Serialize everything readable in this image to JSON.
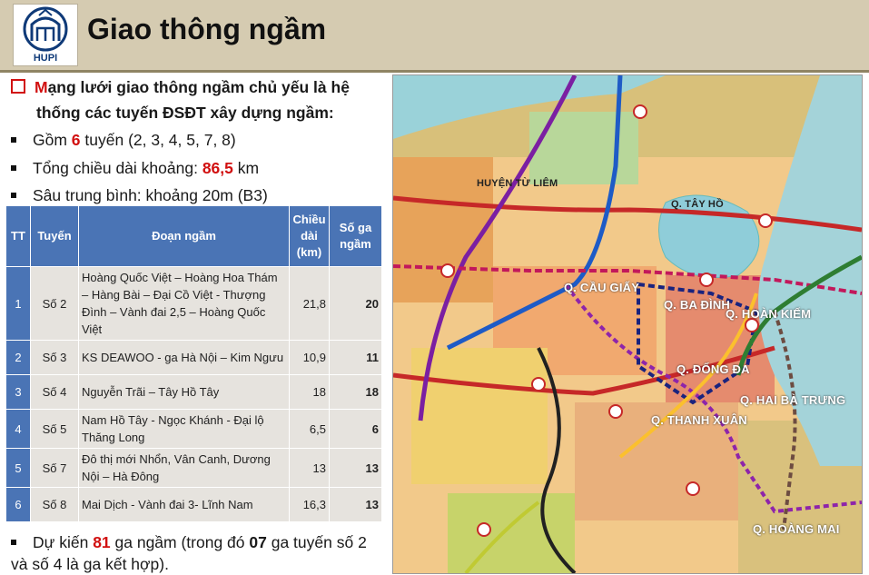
{
  "header": {
    "title": "Giao thông ngầm",
    "logo_text": "HUPI"
  },
  "intro": {
    "lead": "M",
    "text_line1": "ạng lưới giao thông ngầm chủ yếu là hệ",
    "text_line2": "thống các tuyến ĐSĐT xây dựng ngầm:"
  },
  "bullets": {
    "b1_pre": "Gồm ",
    "b1_num": "6",
    "b1_post": " tuyến (2, 3, 4, 5, 7, 8)",
    "b2_pre": "Tổng chiều dài khoảng: ",
    "b2_num": "86,5",
    "b2_post": " km",
    "b3": "Sâu trung bình: khoảng 20m (B3)"
  },
  "table": {
    "headers": [
      "TT",
      "Tuyến",
      "Đoạn ngầm",
      "Chiều dài (km)",
      "Số ga ngầm"
    ],
    "rows": [
      {
        "tt": "1",
        "tuyen": "Số 2",
        "doan": "Hoàng Quốc Việt – Hoàng Hoa Thám – Hàng Bài – Đại Cồ Việt - Thượng Đình – Vành đai 2,5 – Hoàng Quốc Việt",
        "dai": "21,8",
        "ga": "20"
      },
      {
        "tt": "2",
        "tuyen": "Số 3",
        "doan": "KS DEAWOO - ga Hà Nội – Kim Ngưu",
        "dai": "10,9",
        "ga": "11"
      },
      {
        "tt": "3",
        "tuyen": "Số 4",
        "doan": "Nguyễn Trãi – Tây Hồ Tây",
        "dai": "18",
        "ga": "18"
      },
      {
        "tt": "4",
        "tuyen": "Số 5",
        "doan": "Nam Hồ Tây - Ngọc Khánh - Đại lộ Thăng Long",
        "dai": "6,5",
        "ga": "6"
      },
      {
        "tt": "5",
        "tuyen": "Số 7",
        "doan": "Đô thị mới Nhổn, Vân Canh, Dương Nội – Hà Đông",
        "dai": "13",
        "ga": "13"
      },
      {
        "tt": "6",
        "tuyen": "Số 8",
        "doan": "Mai Dịch - Vành đai 3- Lĩnh Nam",
        "dai": "16,3",
        "ga": "13"
      }
    ]
  },
  "bottom": {
    "pre": "Dự kiến ",
    "num": "81",
    "mid": " ga ngầm (trong đó ",
    "num2": "07",
    "post": " ga tuyến số 2 và số 4 là ga kết hợp)."
  },
  "map": {
    "labels": [
      "HUYỆN TỪ LIÊM",
      "Q. TÂY HỒ",
      "Q. CẦU GIẤY",
      "Q. BA ĐÌNH",
      "Q. HOÀN KIẾM",
      "Q. ĐỐNG ĐA",
      "Q. HAI BÀ TRƯNG",
      "Q. THANH XUÂN",
      "Q. HOÀNG MAI"
    ]
  },
  "colors": {
    "header_bg": "#d5cbb1",
    "table_header": "#4a74b5",
    "accent_red": "#d11010"
  }
}
